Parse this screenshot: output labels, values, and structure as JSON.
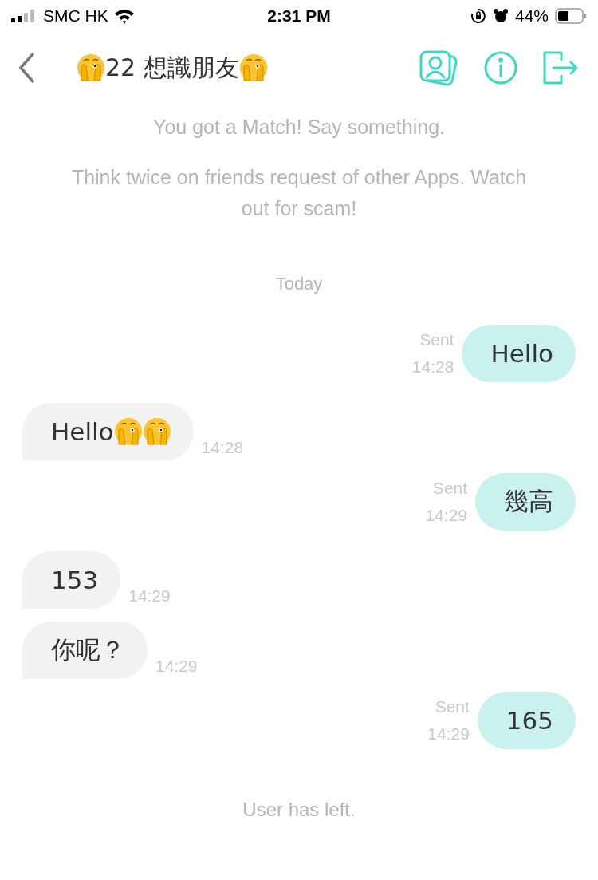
{
  "status_bar": {
    "carrier": "SMC HK",
    "time": "2:31 PM",
    "battery": "44%"
  },
  "header": {
    "title": [
      {
        "kind": "emoji"
      },
      {
        "kind": "text",
        "text": "22 想識朋友"
      },
      {
        "kind": "emoji"
      }
    ]
  },
  "notices": [
    "You got a Match! Say something.",
    "Think twice on friends request of other Apps. Watch out for scam!"
  ],
  "date_divider": "Today",
  "messages": [
    {
      "outgoing": true,
      "status": "Sent",
      "time": "14:28",
      "parts": [
        {
          "kind": "text",
          "text": "Hello"
        }
      ]
    },
    {
      "outgoing": false,
      "time": "14:28",
      "parts": [
        {
          "kind": "text",
          "text": "Hello"
        },
        {
          "kind": "emoji"
        },
        {
          "kind": "emoji"
        }
      ]
    },
    {
      "outgoing": true,
      "status": "Sent",
      "time": "14:29",
      "parts": [
        {
          "kind": "text",
          "text": "幾高"
        }
      ]
    },
    {
      "outgoing": false,
      "time": "14:29",
      "parts": [
        {
          "kind": "text",
          "text": "153"
        }
      ]
    },
    {
      "outgoing": false,
      "time": "14:29",
      "parts": [
        {
          "kind": "text",
          "text": "你呢？"
        }
      ]
    },
    {
      "outgoing": true,
      "status": "Sent",
      "time": "14:29",
      "parts": [
        {
          "kind": "text",
          "text": "165"
        }
      ]
    }
  ],
  "footer_notice": "User has left."
}
